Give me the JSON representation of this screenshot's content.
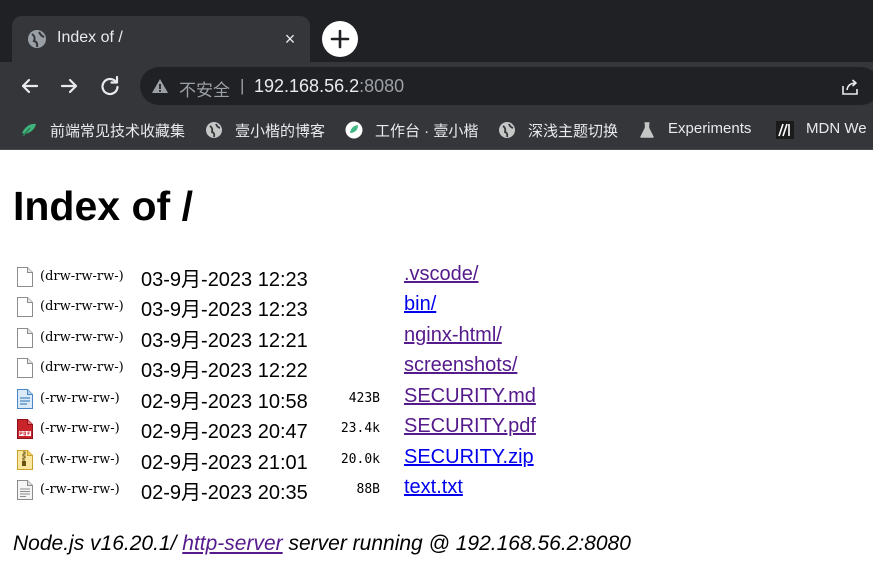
{
  "browser": {
    "tab_title": "Index of /",
    "tab_close": "×",
    "address_insecure": "不安全",
    "address_separator": "|",
    "address_host": "192.168.56.2",
    "address_port": ":8080",
    "bookmarks": [
      {
        "label": "前端常见技术收藏集",
        "icon": "leaf-icon"
      },
      {
        "label": "壹小楷的博客",
        "icon": "globe-icon"
      },
      {
        "label": "工作台 · 壹小楷",
        "icon": "leaf-circle-icon"
      },
      {
        "label": "深浅主题切换",
        "icon": "globe-icon"
      },
      {
        "label": "Experiments",
        "icon": "flask-icon"
      },
      {
        "label": "MDN We",
        "icon": "mdn-icon"
      }
    ]
  },
  "page": {
    "title": "Index of /",
    "entries": [
      {
        "perm": "(drw-rw-rw-)",
        "date": "03-9月-2023 12:23",
        "size": "",
        "name": ".vscode/",
        "icon": "blank-file-icon",
        "visited": true
      },
      {
        "perm": "(drw-rw-rw-)",
        "date": "03-9月-2023 12:23",
        "size": "",
        "name": "bin/",
        "icon": "blank-file-icon",
        "visited": false
      },
      {
        "perm": "(drw-rw-rw-)",
        "date": "03-9月-2023 12:21",
        "size": "",
        "name": "nginx-html/",
        "icon": "blank-file-icon",
        "visited": true
      },
      {
        "perm": "(drw-rw-rw-)",
        "date": "03-9月-2023 12:22",
        "size": "",
        "name": "screenshots/",
        "icon": "blank-file-icon",
        "visited": true
      },
      {
        "perm": "(-rw-rw-rw-)",
        "date": "02-9月-2023 10:58",
        "size": "423B",
        "name": "SECURITY.md",
        "icon": "markdown-file-icon",
        "visited": true
      },
      {
        "perm": "(-rw-rw-rw-)",
        "date": "02-9月-2023 20:47",
        "size": "23.4k",
        "name": "SECURITY.pdf",
        "icon": "pdf-file-icon",
        "visited": true
      },
      {
        "perm": "(-rw-rw-rw-)",
        "date": "02-9月-2023 21:01",
        "size": "20.0k",
        "name": "SECURITY.zip",
        "icon": "zip-file-icon",
        "visited": false
      },
      {
        "perm": "(-rw-rw-rw-)",
        "date": "02-9月-2023 20:35",
        "size": "88B",
        "name": "text.txt",
        "icon": "text-file-icon",
        "visited": false
      }
    ],
    "footer_prefix": "Node.js v16.20.1/ ",
    "footer_link": "http-server",
    "footer_suffix": " server running @ 192.168.56.2:8080"
  }
}
